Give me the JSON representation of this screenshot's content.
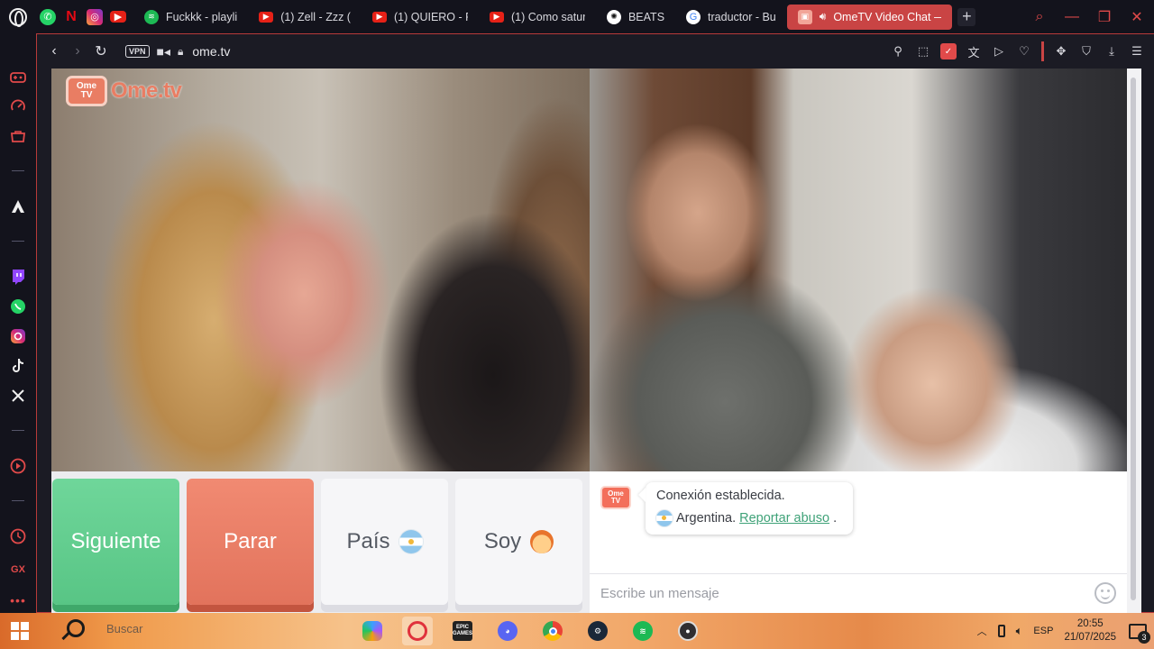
{
  "browser": {
    "pinned": [
      "whatsapp-icon",
      "netflix-icon",
      "instagram-icon",
      "youtube-icon"
    ],
    "tabs": [
      {
        "title": "Fuckkk - playli",
        "icon": "spotify-icon",
        "color": "#1db954"
      },
      {
        "title": "(1) Zell - Zzz (",
        "icon": "youtube-icon",
        "color": "#e62117"
      },
      {
        "title": "(1) QUIERO - F",
        "icon": "youtube-icon",
        "color": "#e62117"
      },
      {
        "title": "(1) Como satur",
        "icon": "youtube-icon",
        "color": "#e62117"
      },
      {
        "title": "BEATS",
        "icon": "chatgpt-icon",
        "color": "#ffffff"
      },
      {
        "title": "traductor - Bu",
        "icon": "google-icon",
        "color": "#4285f4"
      },
      {
        "title": "OmeTV Video Chat —",
        "icon": "ometv-icon",
        "color": "#c94444",
        "active": true
      }
    ],
    "url": "ome.tv",
    "vpn_label": "VPN"
  },
  "page": {
    "logo": {
      "badge": "Ome\nTV",
      "brand": "Ome.tv"
    },
    "buttons": {
      "next": "Siguiente",
      "stop": "Parar",
      "country": "País",
      "gender": "Soy"
    },
    "chat": {
      "logo_badge": "Ome\nTV",
      "status": "Conexión establecida.",
      "country": "Argentina.",
      "report_link": "Reportar abuso",
      "report_suffix": ".",
      "input_placeholder": "Escribe un mensaje"
    }
  },
  "taskbar": {
    "search_placeholder": "Buscar",
    "apps": [
      "copilot-icon",
      "opera-icon",
      "epic-games-icon",
      "discord-icon",
      "chrome-icon",
      "steam-icon",
      "spotify-icon",
      "obs-icon"
    ],
    "epic_label": "EPIC\nGAMES",
    "language": "ESP",
    "time": "20:55",
    "date": "21/07/2025",
    "notifications": "3"
  },
  "colors": {
    "accent": "#c94444",
    "next_button": "#5fcb8b",
    "stop_button": "#e97d63",
    "link": "#3fa278"
  }
}
